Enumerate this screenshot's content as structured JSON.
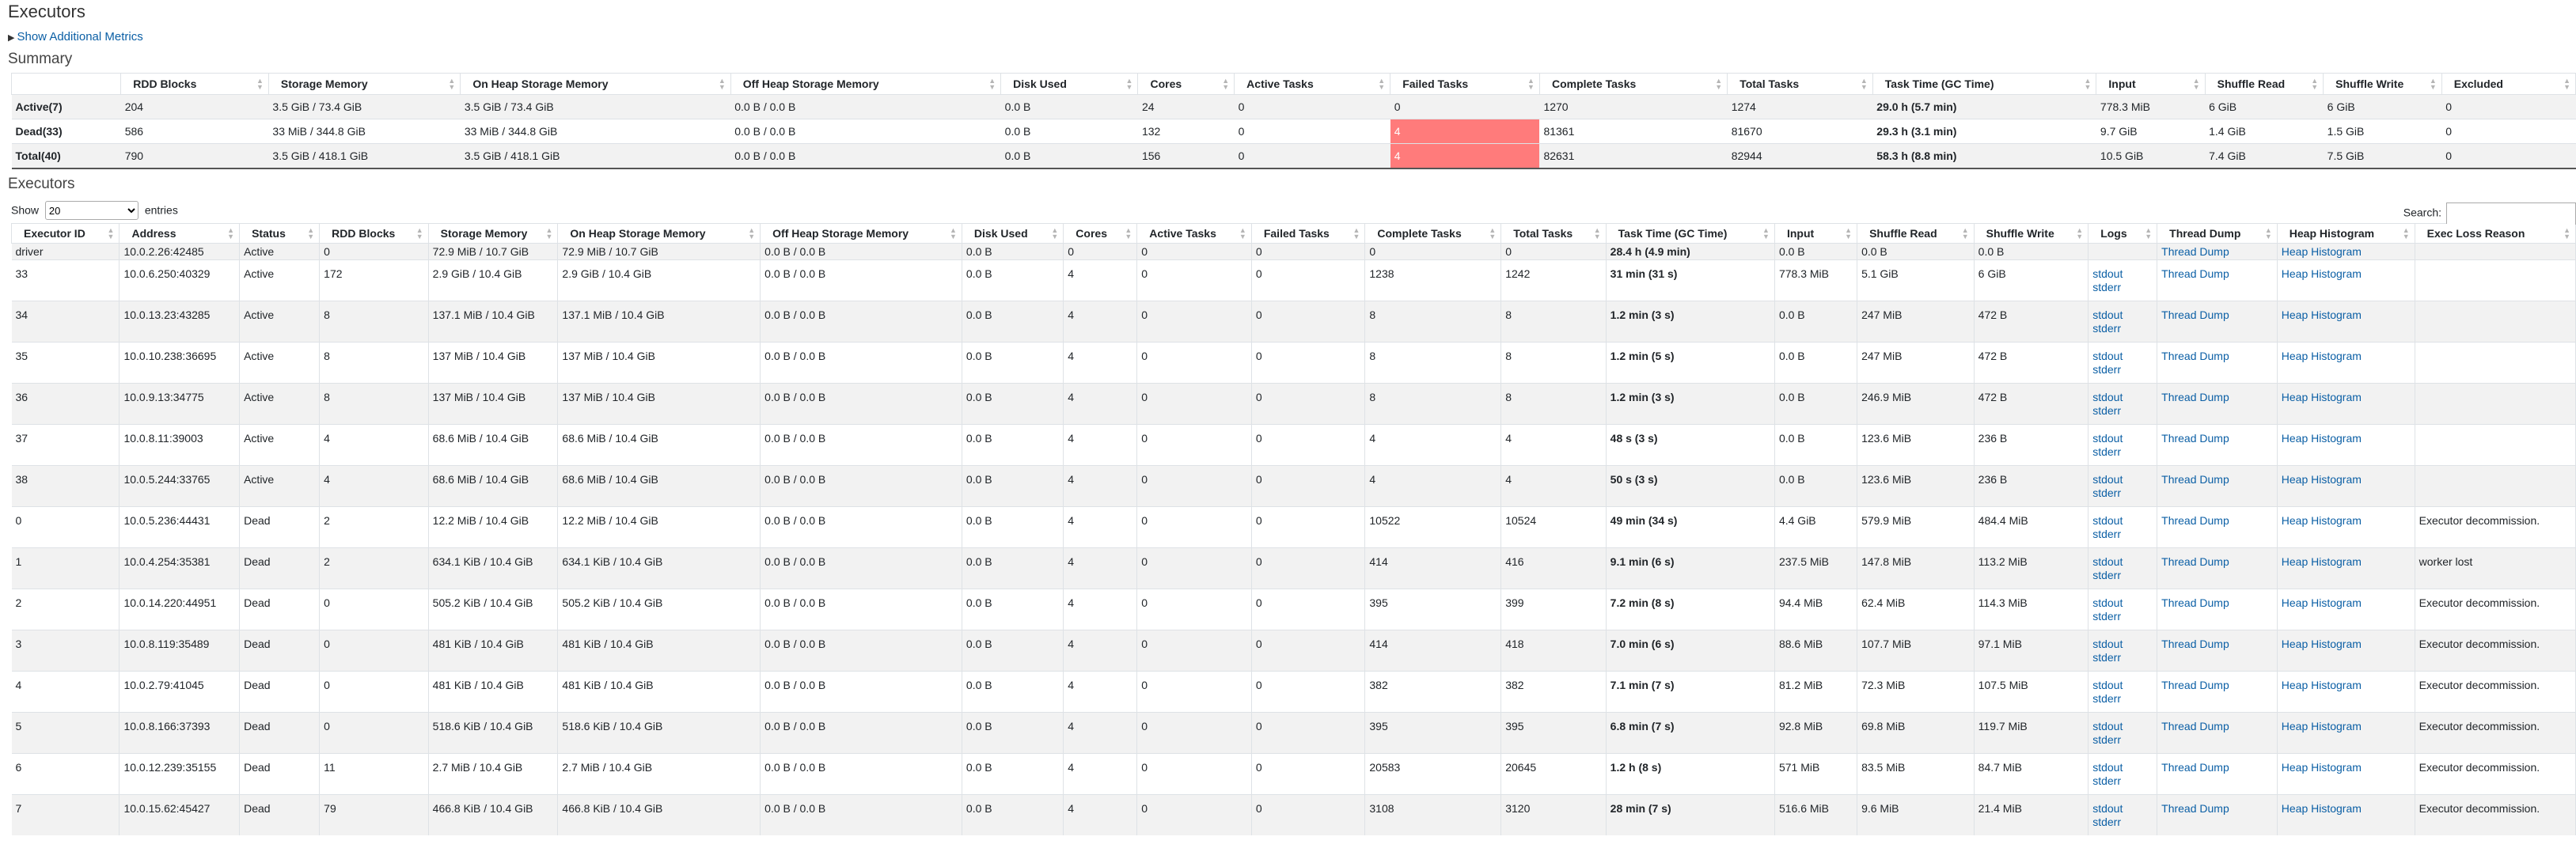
{
  "page": {
    "title": "Executors",
    "show_additional_metrics": "Show Additional Metrics",
    "summary_heading": "Summary",
    "executors_heading": "Executors"
  },
  "summary": {
    "headers": [
      "",
      "RDD Blocks",
      "Storage Memory",
      "On Heap Storage Memory",
      "Off Heap Storage Memory",
      "Disk Used",
      "Cores",
      "Active Tasks",
      "Failed Tasks",
      "Complete Tasks",
      "Total Tasks",
      "Task Time (GC Time)",
      "Input",
      "Shuffle Read",
      "Shuffle Write",
      "Excluded"
    ],
    "rows": [
      [
        "Active(7)",
        "204",
        "3.5 GiB / 73.4 GiB",
        "3.5 GiB / 73.4 GiB",
        "0.0 B / 0.0 B",
        "0.0 B",
        "24",
        "0",
        "0",
        "1270",
        "1274",
        "29.0 h (5.7 min)",
        "778.3 MiB",
        "6 GiB",
        "6 GiB",
        "0"
      ],
      [
        "Dead(33)",
        "586",
        "33 MiB / 344.8 GiB",
        "33 MiB / 344.8 GiB",
        "0.0 B / 0.0 B",
        "0.0 B",
        "132",
        "0",
        "4",
        "81361",
        "81670",
        "29.3 h (3.1 min)",
        "9.7 GiB",
        "1.4 GiB",
        "1.5 GiB",
        "0"
      ],
      [
        "Total(40)",
        "790",
        "3.5 GiB / 418.1 GiB",
        "3.5 GiB / 418.1 GiB",
        "0.0 B / 0.0 B",
        "0.0 B",
        "156",
        "0",
        "4",
        "82631",
        "82944",
        "58.3 h (8.8 min)",
        "10.5 GiB",
        "7.4 GiB",
        "7.5 GiB",
        "0"
      ]
    ],
    "failed_highlight_color": "#ff7b7b"
  },
  "controls": {
    "show_label": "Show",
    "entries_value": "20",
    "entries_label": "entries",
    "search_label": "Search:",
    "search_value": ""
  },
  "executors": {
    "headers": [
      "Executor ID",
      "Address",
      "Status",
      "RDD Blocks",
      "Storage Memory",
      "On Heap Storage Memory",
      "Off Heap Storage Memory",
      "Disk Used",
      "Cores",
      "Active Tasks",
      "Failed Tasks",
      "Complete Tasks",
      "Total Tasks",
      "Task Time (GC Time)",
      "Input",
      "Shuffle Read",
      "Shuffle Write",
      "Logs",
      "Thread Dump",
      "Heap Histogram",
      "Exec Loss Reason"
    ],
    "link_labels": {
      "stdout": "stdout",
      "stderr": "stderr",
      "thread_dump": "Thread Dump",
      "heap_histogram": "Heap Histogram"
    },
    "rows": [
      {
        "id": "driver",
        "address": "10.0.2.26:42485",
        "status": "Active",
        "rdd": "0",
        "storage": "72.9 MiB / 10.7 GiB",
        "onheap": "72.9 MiB / 10.7 GiB",
        "offheap": "0.0 B / 0.0 B",
        "disk": "0.0 B",
        "cores": "0",
        "active": "0",
        "failed": "0",
        "complete": "0",
        "total": "0",
        "tasktime": "28.4 h (4.9 min)",
        "input": "0.0 B",
        "shread": "0.0 B",
        "shwrite": "0.0 B",
        "logs": false,
        "reason": ""
      },
      {
        "id": "33",
        "address": "10.0.6.250:40329",
        "status": "Active",
        "rdd": "172",
        "storage": "2.9 GiB / 10.4 GiB",
        "onheap": "2.9 GiB / 10.4 GiB",
        "offheap": "0.0 B / 0.0 B",
        "disk": "0.0 B",
        "cores": "4",
        "active": "0",
        "failed": "0",
        "complete": "1238",
        "total": "1242",
        "tasktime": "31 min (31 s)",
        "input": "778.3 MiB",
        "shread": "5.1 GiB",
        "shwrite": "6 GiB",
        "logs": true,
        "reason": ""
      },
      {
        "id": "34",
        "address": "10.0.13.23:43285",
        "status": "Active",
        "rdd": "8",
        "storage": "137.1 MiB / 10.4 GiB",
        "onheap": "137.1 MiB / 10.4 GiB",
        "offheap": "0.0 B / 0.0 B",
        "disk": "0.0 B",
        "cores": "4",
        "active": "0",
        "failed": "0",
        "complete": "8",
        "total": "8",
        "tasktime": "1.2 min (3 s)",
        "input": "0.0 B",
        "shread": "247 MiB",
        "shwrite": "472 B",
        "logs": true,
        "reason": ""
      },
      {
        "id": "35",
        "address": "10.0.10.238:36695",
        "status": "Active",
        "rdd": "8",
        "storage": "137 MiB / 10.4 GiB",
        "onheap": "137 MiB / 10.4 GiB",
        "offheap": "0.0 B / 0.0 B",
        "disk": "0.0 B",
        "cores": "4",
        "active": "0",
        "failed": "0",
        "complete": "8",
        "total": "8",
        "tasktime": "1.2 min (5 s)",
        "input": "0.0 B",
        "shread": "247 MiB",
        "shwrite": "472 B",
        "logs": true,
        "reason": ""
      },
      {
        "id": "36",
        "address": "10.0.9.13:34775",
        "status": "Active",
        "rdd": "8",
        "storage": "137 MiB / 10.4 GiB",
        "onheap": "137 MiB / 10.4 GiB",
        "offheap": "0.0 B / 0.0 B",
        "disk": "0.0 B",
        "cores": "4",
        "active": "0",
        "failed": "0",
        "complete": "8",
        "total": "8",
        "tasktime": "1.2 min (3 s)",
        "input": "0.0 B",
        "shread": "246.9 MiB",
        "shwrite": "472 B",
        "logs": true,
        "reason": ""
      },
      {
        "id": "37",
        "address": "10.0.8.11:39003",
        "status": "Active",
        "rdd": "4",
        "storage": "68.6 MiB / 10.4 GiB",
        "onheap": "68.6 MiB / 10.4 GiB",
        "offheap": "0.0 B / 0.0 B",
        "disk": "0.0 B",
        "cores": "4",
        "active": "0",
        "failed": "0",
        "complete": "4",
        "total": "4",
        "tasktime": "48 s (3 s)",
        "input": "0.0 B",
        "shread": "123.6 MiB",
        "shwrite": "236 B",
        "logs": true,
        "reason": ""
      },
      {
        "id": "38",
        "address": "10.0.5.244:33765",
        "status": "Active",
        "rdd": "4",
        "storage": "68.6 MiB / 10.4 GiB",
        "onheap": "68.6 MiB / 10.4 GiB",
        "offheap": "0.0 B / 0.0 B",
        "disk": "0.0 B",
        "cores": "4",
        "active": "0",
        "failed": "0",
        "complete": "4",
        "total": "4",
        "tasktime": "50 s (3 s)",
        "input": "0.0 B",
        "shread": "123.6 MiB",
        "shwrite": "236 B",
        "logs": true,
        "reason": ""
      },
      {
        "id": "0",
        "address": "10.0.5.236:44431",
        "status": "Dead",
        "rdd": "2",
        "storage": "12.2 MiB / 10.4 GiB",
        "onheap": "12.2 MiB / 10.4 GiB",
        "offheap": "0.0 B / 0.0 B",
        "disk": "0.0 B",
        "cores": "4",
        "active": "0",
        "failed": "0",
        "complete": "10522",
        "total": "10524",
        "tasktime": "49 min (34 s)",
        "input": "4.4 GiB",
        "shread": "579.9 MiB",
        "shwrite": "484.4 MiB",
        "logs": true,
        "reason": "Executor decommission."
      },
      {
        "id": "1",
        "address": "10.0.4.254:35381",
        "status": "Dead",
        "rdd": "2",
        "storage": "634.1 KiB / 10.4 GiB",
        "onheap": "634.1 KiB / 10.4 GiB",
        "offheap": "0.0 B / 0.0 B",
        "disk": "0.0 B",
        "cores": "4",
        "active": "0",
        "failed": "0",
        "complete": "414",
        "total": "416",
        "tasktime": "9.1 min (6 s)",
        "input": "237.5 MiB",
        "shread": "147.8 MiB",
        "shwrite": "113.2 MiB",
        "logs": true,
        "reason": "worker lost"
      },
      {
        "id": "2",
        "address": "10.0.14.220:44951",
        "status": "Dead",
        "rdd": "0",
        "storage": "505.2 KiB / 10.4 GiB",
        "onheap": "505.2 KiB / 10.4 GiB",
        "offheap": "0.0 B / 0.0 B",
        "disk": "0.0 B",
        "cores": "4",
        "active": "0",
        "failed": "0",
        "complete": "395",
        "total": "399",
        "tasktime": "7.2 min (8 s)",
        "input": "94.4 MiB",
        "shread": "62.4 MiB",
        "shwrite": "114.3 MiB",
        "logs": true,
        "reason": "Executor decommission."
      },
      {
        "id": "3",
        "address": "10.0.8.119:35489",
        "status": "Dead",
        "rdd": "0",
        "storage": "481 KiB / 10.4 GiB",
        "onheap": "481 KiB / 10.4 GiB",
        "offheap": "0.0 B / 0.0 B",
        "disk": "0.0 B",
        "cores": "4",
        "active": "0",
        "failed": "0",
        "complete": "414",
        "total": "418",
        "tasktime": "7.0 min (6 s)",
        "input": "88.6 MiB",
        "shread": "107.7 MiB",
        "shwrite": "97.1 MiB",
        "logs": true,
        "reason": "Executor decommission."
      },
      {
        "id": "4",
        "address": "10.0.2.79:41045",
        "status": "Dead",
        "rdd": "0",
        "storage": "481 KiB / 10.4 GiB",
        "onheap": "481 KiB / 10.4 GiB",
        "offheap": "0.0 B / 0.0 B",
        "disk": "0.0 B",
        "cores": "4",
        "active": "0",
        "failed": "0",
        "complete": "382",
        "total": "382",
        "tasktime": "7.1 min (7 s)",
        "input": "81.2 MiB",
        "shread": "72.3 MiB",
        "shwrite": "107.5 MiB",
        "logs": true,
        "reason": "Executor decommission."
      },
      {
        "id": "5",
        "address": "10.0.8.166:37393",
        "status": "Dead",
        "rdd": "0",
        "storage": "518.6 KiB / 10.4 GiB",
        "onheap": "518.6 KiB / 10.4 GiB",
        "offheap": "0.0 B / 0.0 B",
        "disk": "0.0 B",
        "cores": "4",
        "active": "0",
        "failed": "0",
        "complete": "395",
        "total": "395",
        "tasktime": "6.8 min (7 s)",
        "input": "92.8 MiB",
        "shread": "69.8 MiB",
        "shwrite": "119.7 MiB",
        "logs": true,
        "reason": "Executor decommission."
      },
      {
        "id": "6",
        "address": "10.0.12.239:35155",
        "status": "Dead",
        "rdd": "11",
        "storage": "2.7 MiB / 10.4 GiB",
        "onheap": "2.7 MiB / 10.4 GiB",
        "offheap": "0.0 B / 0.0 B",
        "disk": "0.0 B",
        "cores": "4",
        "active": "0",
        "failed": "0",
        "complete": "20583",
        "total": "20645",
        "tasktime": "1.2 h (8 s)",
        "input": "571 MiB",
        "shread": "83.5 MiB",
        "shwrite": "84.7 MiB",
        "logs": true,
        "reason": "Executor decommission."
      },
      {
        "id": "7",
        "address": "10.0.15.62:45427",
        "status": "Dead",
        "rdd": "79",
        "storage": "466.8 KiB / 10.4 GiB",
        "onheap": "466.8 KiB / 10.4 GiB",
        "offheap": "0.0 B / 0.0 B",
        "disk": "0.0 B",
        "cores": "4",
        "active": "0",
        "failed": "0",
        "complete": "3108",
        "total": "3120",
        "tasktime": "28 min (7 s)",
        "input": "516.6 MiB",
        "shread": "9.6 MiB",
        "shwrite": "21.4 MiB",
        "logs": true,
        "reason": "Executor decommission."
      }
    ]
  }
}
